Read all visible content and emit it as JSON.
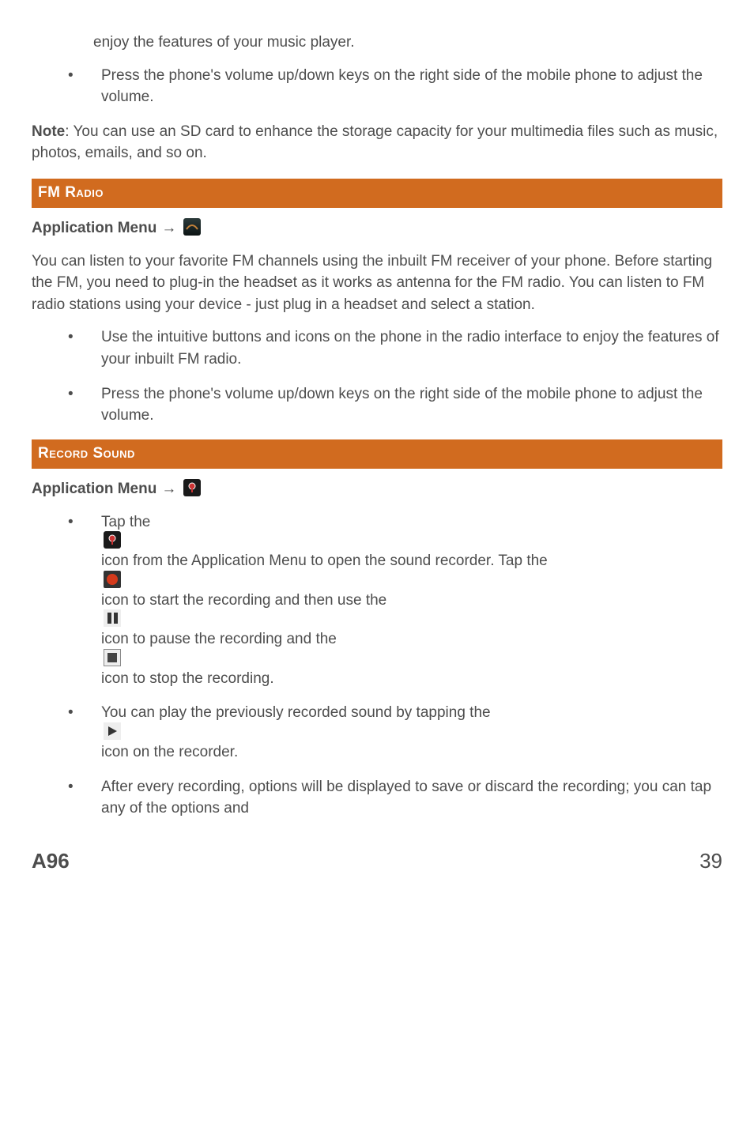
{
  "intro": {
    "continued_line": "enjoy the features of your music player.",
    "volume_bullet": "Press the phone's volume up/down keys on the right side of the mobile phone to adjust the volume."
  },
  "note": {
    "label": "Note",
    "text": ": You can use an SD card to enhance the storage capacity for your multimedia files such as music, photos, emails, and so on."
  },
  "fm": {
    "heading": "FM Radio",
    "menu_label": "Application Menu",
    "arrow": "→",
    "desc": "You can listen to your favorite FM channels using the inbuilt FM receiver of your phone. Before starting the FM, you need to plug-in the headset as it works as antenna for the FM radio. You can listen to FM radio stations using your device - just plug in a headset and select a station.",
    "bullets": [
      "Use the intuitive buttons and icons on the phone in the radio interface to enjoy the features of your inbuilt FM radio.",
      "Press the phone's volume up/down keys on the right side of the mobile phone to adjust the volume."
    ]
  },
  "record": {
    "heading": "Record Sound",
    "menu_label": "Application Menu",
    "arrow": "→",
    "bullet1": {
      "pre_tap": "Tap the ",
      "after_tap": " icon from the Application Menu to open the sound recorder. Tap the ",
      "start_rec": " icon to start the recording and then use the ",
      "pause_rec": " icon to pause the recording and the ",
      "stop_rec": " icon to stop the recording."
    },
    "bullet2": {
      "pre": "You can play the previously recorded sound by tapping the ",
      "post": " icon on the recorder."
    },
    "bullet3": "After every recording, options will be displayed to save or discard the recording; you can tap any of the options and"
  },
  "footer": {
    "model": "A96",
    "page": "39"
  }
}
